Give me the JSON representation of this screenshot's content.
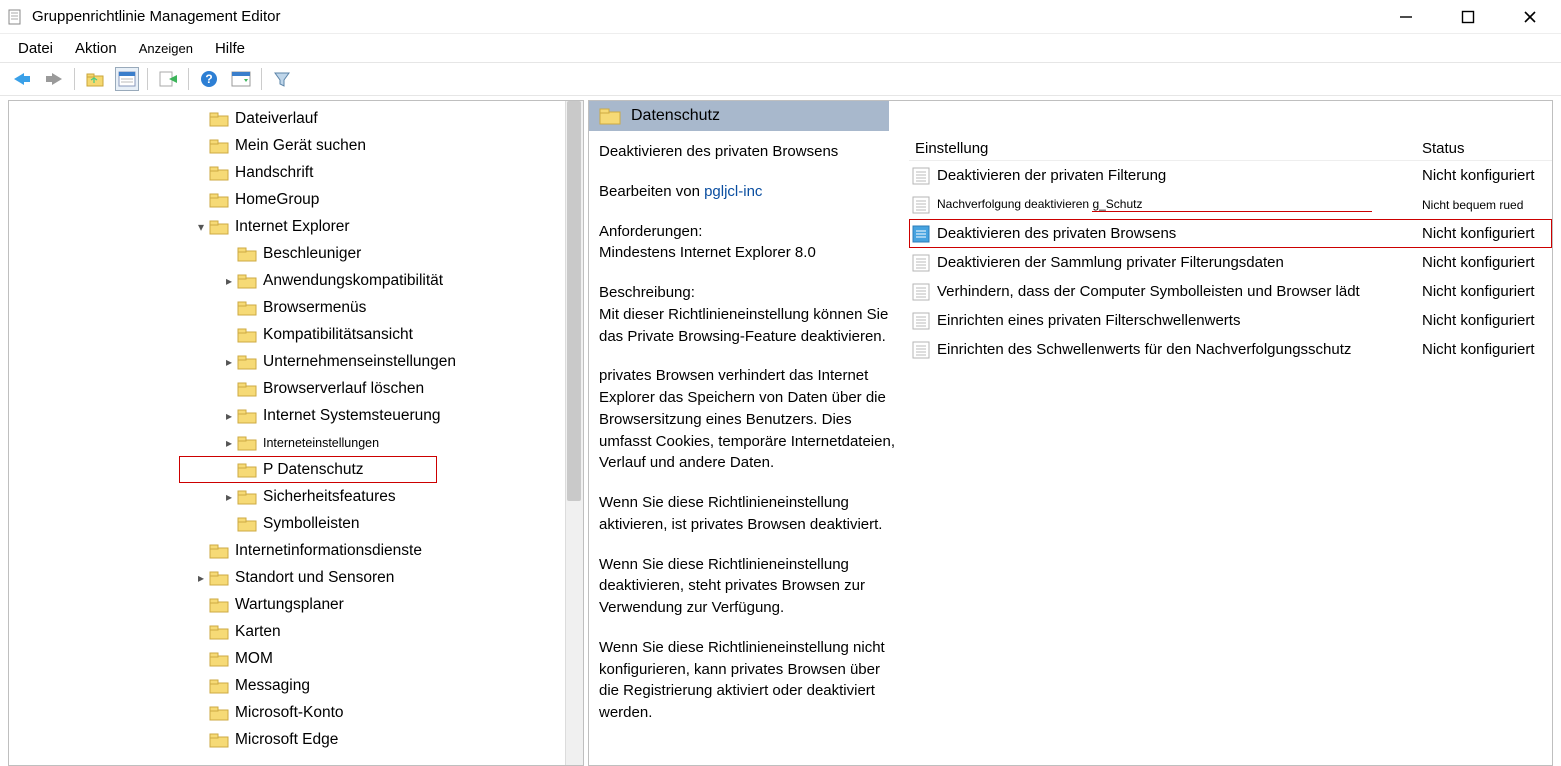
{
  "window": {
    "title": "Gruppenrichtlinie Management Editor"
  },
  "menubar": {
    "items": [
      "Datei",
      "Aktion",
      "Anzeigen",
      "Hilfe"
    ]
  },
  "toolbar_icons": [
    "back",
    "forward",
    "up",
    "props",
    "export",
    "help",
    "view-options",
    "filter"
  ],
  "tree": [
    {
      "indent": 3,
      "exp": "",
      "label": "Dateiverlauf"
    },
    {
      "indent": 3,
      "exp": "",
      "label": "Mein Gerät suchen"
    },
    {
      "indent": 3,
      "exp": "",
      "label": "Handschrift"
    },
    {
      "indent": 3,
      "exp": "",
      "label": "HomeGroup"
    },
    {
      "indent": 3,
      "exp": "v",
      "label": "Internet Explorer"
    },
    {
      "indent": 4,
      "exp": "",
      "label": "Beschleuniger"
    },
    {
      "indent": 4,
      "exp": ">",
      "label": "Anwendungskompatibilität"
    },
    {
      "indent": 4,
      "exp": "",
      "label": "Browsermenüs"
    },
    {
      "indent": 4,
      "exp": "",
      "label": "Kompatibilitätsansicht"
    },
    {
      "indent": 4,
      "exp": ">",
      "label": "Unternehmenseinstellungen"
    },
    {
      "indent": 4,
      "exp": "",
      "label": "Browserverlauf löschen"
    },
    {
      "indent": 4,
      "exp": ">",
      "label": "Internet Systemsteuerung"
    },
    {
      "indent": 4,
      "exp": ">",
      "label": "Interneteinstellungen",
      "small": true
    },
    {
      "indent": 4,
      "exp": "",
      "label": "P Datenschutz",
      "hl": true
    },
    {
      "indent": 4,
      "exp": ">",
      "label": "Sicherheitsfeatures"
    },
    {
      "indent": 4,
      "exp": "",
      "label": "Symbolleisten"
    },
    {
      "indent": 3,
      "exp": "",
      "label": "Internetinformationsdienste"
    },
    {
      "indent": 3,
      "exp": ">",
      "label": "Standort und Sensoren"
    },
    {
      "indent": 3,
      "exp": "",
      "label": "Wartungsplaner"
    },
    {
      "indent": 3,
      "exp": "",
      "label": "Karten"
    },
    {
      "indent": 3,
      "exp": "",
      "label": "MOM"
    },
    {
      "indent": 3,
      "exp": "",
      "label": "Messaging"
    },
    {
      "indent": 3,
      "exp": "",
      "label": "Microsoft-Konto"
    },
    {
      "indent": 3,
      "exp": "",
      "label": "Microsoft Edge"
    }
  ],
  "right": {
    "header": "Datenschutz",
    "policy_title": "Deaktivieren des privaten Browsens",
    "edit_prefix": "Bearbeiten von ",
    "edit_link": "pgljcl-inc",
    "req_label": "Anforderungen:",
    "req_text": "Mindestens Internet Explorer 8.0",
    "desc_label": "Beschreibung:",
    "desc_p1": "Mit dieser Richtlinieneinstellung können Sie das Private Browsing-Feature deaktivieren.",
    "desc_p2": "privates Browsen verhindert das Internet Explorer das Speichern von Daten über die Browsersitzung eines Benutzers. Dies umfasst Cookies, temporäre Internetdateien, Verlauf und andere Daten.",
    "desc_p3": "Wenn Sie diese Richtlinieneinstellung aktivieren, ist privates Browsen deaktiviert.",
    "desc_p4": "Wenn Sie diese Richtlinieneinstellung deaktivieren, steht privates Browsen zur Verwendung zur Verfügung.",
    "desc_p5": "Wenn Sie diese Richtlinieneinstellung nicht konfigurieren, kann privates Browsen über die Registrierung aktiviert oder deaktiviert werden.",
    "col_setting": "Einstellung",
    "col_status": "Status",
    "settings": [
      {
        "name": "Deaktivieren der privaten Filterung",
        "status": "Nicht konfiguriert",
        "icon": "list"
      },
      {
        "name": "Nachverfolgung deaktivieren  g_Schutz",
        "status": "Nicht bequem rued",
        "icon": "list",
        "small": true,
        "redline": true
      },
      {
        "name": "Deaktivieren des privaten Browsens",
        "status": "Nicht konfiguriert",
        "icon": "sel",
        "redbox": true
      },
      {
        "name": "Deaktivieren der Sammlung privater Filterungsdaten",
        "status": "Nicht konfiguriert",
        "icon": "list"
      },
      {
        "name": "Verhindern, dass der Computer Symbolleisten und Browser lädt",
        "status": "Nicht konfiguriert",
        "icon": "list"
      },
      {
        "name": "Einrichten eines privaten Filterschwellenwerts",
        "status": "Nicht konfiguriert",
        "icon": "list"
      },
      {
        "name": "Einrichten des Schwellenwerts für den Nachverfolgungsschutz",
        "status": "Nicht konfiguriert",
        "icon": "list"
      }
    ]
  }
}
